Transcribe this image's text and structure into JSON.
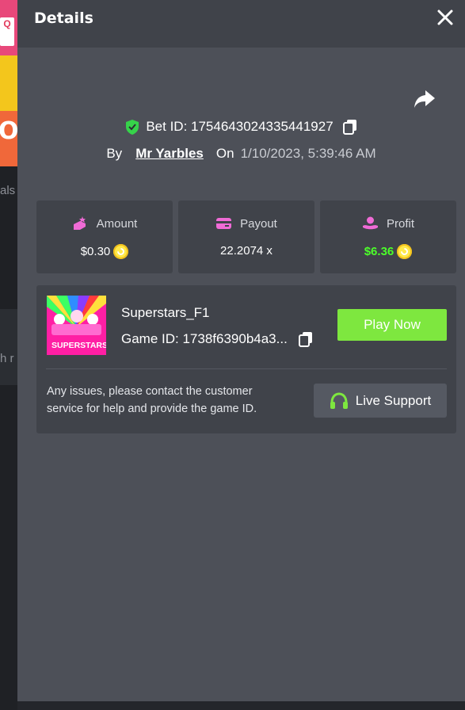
{
  "background": {
    "card_letter": "Q",
    "card_partial_text": "O",
    "partial_text_1": "als",
    "partial_text_2": "h r"
  },
  "drawer": {
    "title": "Details",
    "close_icon": "close-icon",
    "share_icon": "share-icon"
  },
  "bet": {
    "id_label": "Bet ID: 1754643024335441927",
    "by_label": "By",
    "user": "Mr Yarbles",
    "on_label": "On",
    "date": "1/10/2023, 5:39:46 AM"
  },
  "stats": {
    "amount": {
      "label": "Amount",
      "value": "$0.30"
    },
    "payout": {
      "label": "Payout",
      "value": "22.2074 x"
    },
    "profit": {
      "label": "Profit",
      "value": "$6.36"
    }
  },
  "game": {
    "name": "Superstars_F1",
    "id_label": "Game ID: 1738f6390b4a3...",
    "thumb_title": "SUPERSTARS",
    "play_label": "Play Now",
    "support_text": "Any issues, please contact the customer service for help and provide the game ID.",
    "support_label": "Live Support"
  },
  "colors": {
    "drawer_bg": "#4d5058",
    "card_bg": "#40434a",
    "accent_green": "#7ee73f",
    "profit_green": "#4cff2a",
    "icon_pink": "#f06bd6",
    "shield_green": "#36d34a",
    "coin_yellow": "#ffe94a"
  }
}
